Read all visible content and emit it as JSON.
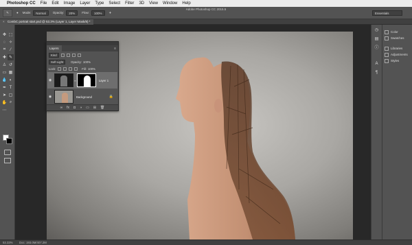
{
  "menubar": {
    "app_name": "Photoshop CC",
    "items": [
      "File",
      "Edit",
      "Image",
      "Layer",
      "Type",
      "Select",
      "Filter",
      "3D",
      "View",
      "Window",
      "Help"
    ]
  },
  "options_bar": {
    "app_title": "Adobe Photoshop CC 2015.5",
    "mode_label": "Mode:",
    "mode_value": "Normal",
    "opacity_label": "Opacity:",
    "opacity_value": "20%",
    "flow_label": "Flow:",
    "flow_value": "100%",
    "workspace": "Essentials"
  },
  "document": {
    "tab_title": "CombC portrait start.psd @ 53.3% (Layer 1, Layer Mask/8) *"
  },
  "layers_panel": {
    "tab_label": "Layers",
    "filter_kind": "Kind",
    "blend_mode": "Soft Light",
    "opacity_label": "Opacity:",
    "opacity_value": "100%",
    "lock_label": "Lock:",
    "fill_label": "Fill:",
    "fill_value": "100%",
    "layers": [
      {
        "name": "Layer 1",
        "selected": true
      },
      {
        "name": "Background",
        "selected": false
      }
    ]
  },
  "right_panels": {
    "items": [
      "Color",
      "Swatches",
      "Libraries",
      "Adjustments",
      "Styles"
    ]
  },
  "status": {
    "zoom": "53.33%",
    "doc_info": "Doc: 193.0M/407.2M"
  },
  "colors": {
    "ui_dark": "#535353",
    "ui_darker": "#404040",
    "foreground": "#ffffff",
    "background": "#000000"
  }
}
